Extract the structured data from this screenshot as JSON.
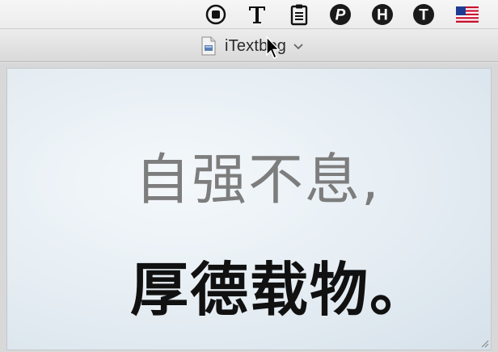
{
  "menubar": {
    "icons": [
      "record-icon",
      "text-tool-icon",
      "clipboard-icon",
      "p-circle-icon",
      "h-circle-icon",
      "t-circle-icon",
      "us-flag-icon"
    ]
  },
  "window": {
    "title": "iTextbog",
    "doc_icon": "document-icon"
  },
  "content": {
    "line1": "自强不息,",
    "line2": "厚德载物。"
  },
  "colors": {
    "line1_text": "#7d7d7d",
    "line2_text": "#111111",
    "content_bg": "#e5edf3"
  }
}
